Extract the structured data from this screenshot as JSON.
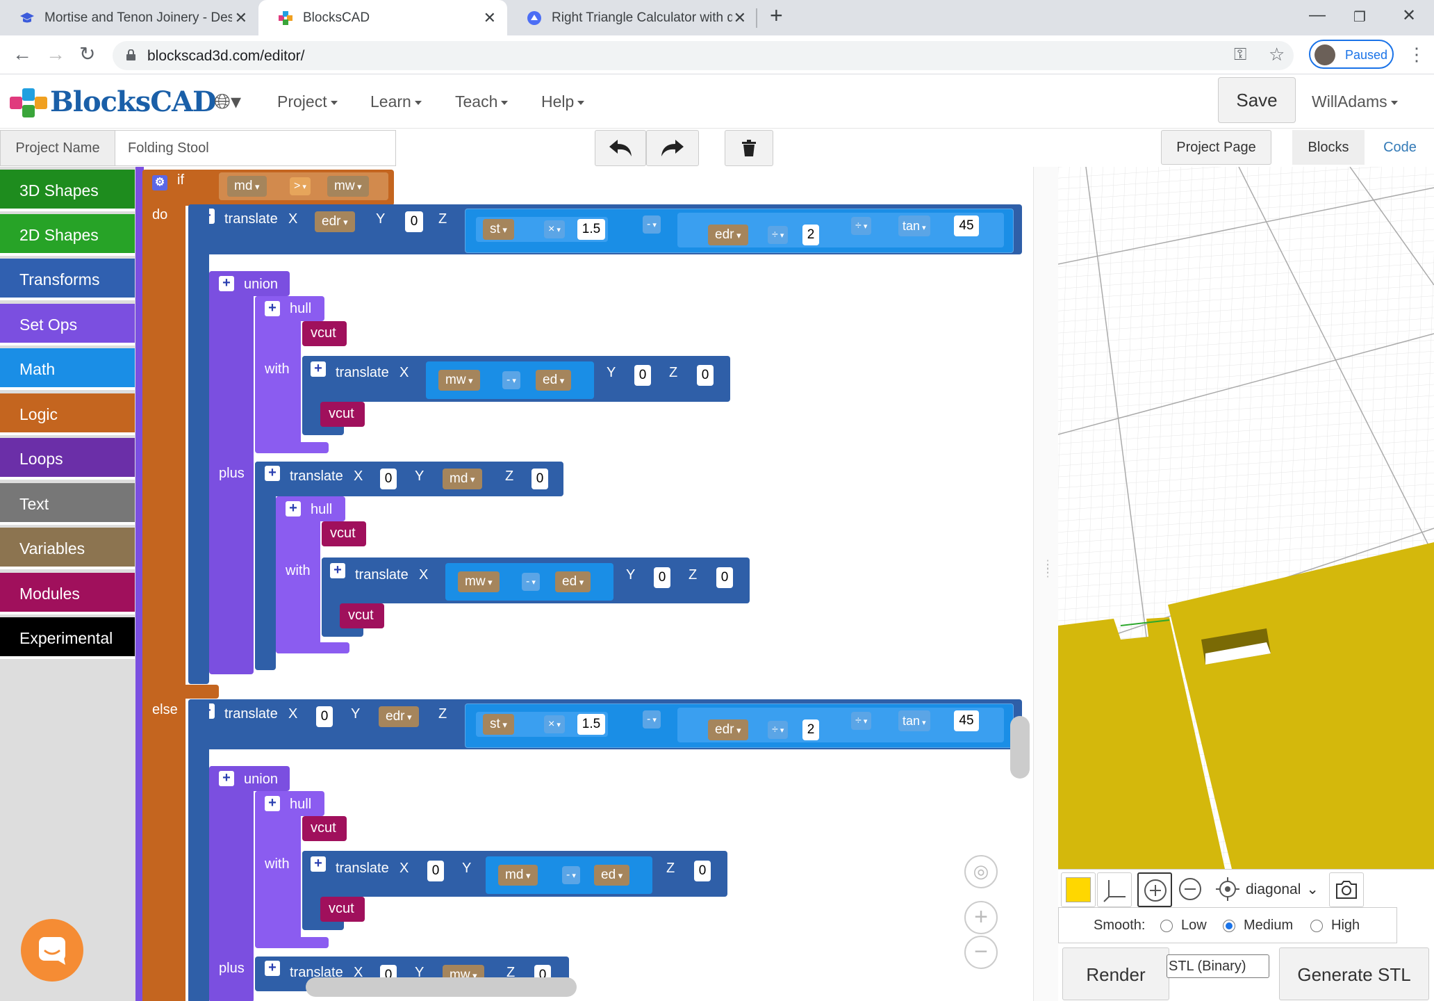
{
  "browser": {
    "tabs": [
      {
        "title": "Mortise and Tenon Joinery - Desi",
        "active": false
      },
      {
        "title": "BlocksCAD",
        "active": true
      },
      {
        "title": "Right Triangle Calculator with det",
        "active": false
      }
    ],
    "url": "blockscad3d.com/editor/",
    "profile_label": "Paused"
  },
  "header": {
    "logo_text": "BlocksCAD",
    "menus": [
      "Project",
      "Learn",
      "Teach",
      "Help"
    ],
    "save_label": "Save",
    "user": "WillAdams"
  },
  "toolbar": {
    "project_name_label": "Project Name",
    "project_name_value": "Folding Stool",
    "project_page_label": "Project Page",
    "view_tabs": [
      "Blocks",
      "Code"
    ]
  },
  "categories": [
    {
      "label": "3D Shapes",
      "color": "#1e8c1e"
    },
    {
      "label": "2D Shapes",
      "color": "#27a327"
    },
    {
      "label": "Transforms",
      "color": "#3060b0"
    },
    {
      "label": "Set Ops",
      "color": "#7b4fe0"
    },
    {
      "label": "Math",
      "color": "#1a8ee6"
    },
    {
      "label": "Logic",
      "color": "#c4651f"
    },
    {
      "label": "Loops",
      "color": "#6b2fa8"
    },
    {
      "label": "Text",
      "color": "#777777"
    },
    {
      "label": "Variables",
      "color": "#8c7450"
    },
    {
      "label": "Modules",
      "color": "#a0105c"
    },
    {
      "label": "Experimental",
      "color": "#000000"
    }
  ],
  "blocks": {
    "if_kw": "if",
    "do_kw": "do",
    "else_kw": "else",
    "cond_left": "md",
    "cond_op": ">",
    "cond_right": "mw",
    "translate": "translate",
    "union": "union",
    "hull": "hull",
    "with": "with",
    "plus": "plus",
    "vcut": "vcut",
    "x": "X",
    "y": "Y",
    "z": "Z",
    "v_edr": "edr",
    "v_st": "st",
    "v_mw": "mw",
    "v_md": "md",
    "v_ed": "ed",
    "n0": "0",
    "n2": "2",
    "n15": "1.5",
    "n45": "45",
    "op_mul": "×",
    "op_minus": "-",
    "op_div": "÷",
    "tan": "tan"
  },
  "viewer": {
    "view_select": "diagonal",
    "smooth_label": "Smooth:",
    "smooth_options": [
      "Low",
      "Medium",
      "High"
    ],
    "smooth_selected": "Medium",
    "render_label": "Render",
    "format_select": "STL (Binary)",
    "generate_label": "Generate STL",
    "model_color": "#ffd700"
  }
}
